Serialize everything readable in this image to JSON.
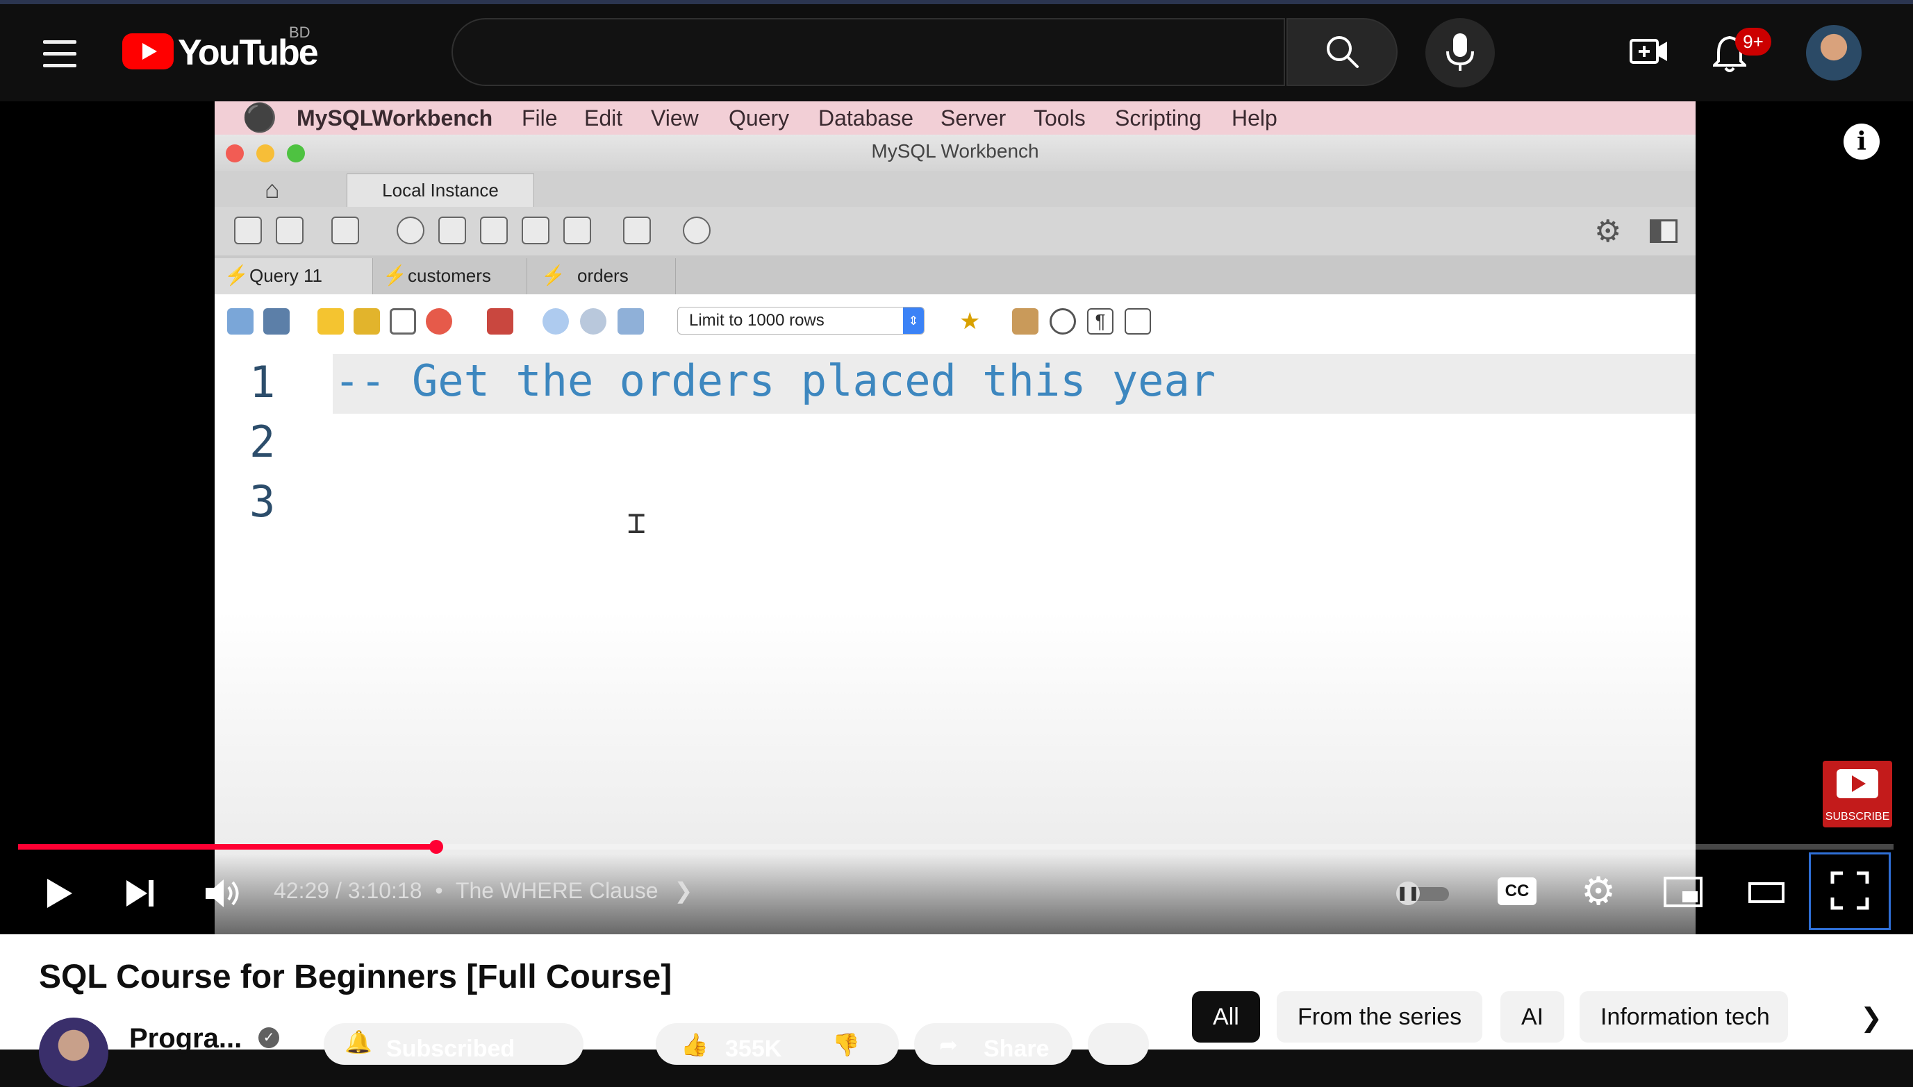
{
  "header": {
    "logo_text": "YouTube",
    "region": "BD",
    "search_placeholder": "",
    "notification_count": "9+",
    "icons": [
      "menu-icon",
      "youtube-logo",
      "search-icon",
      "mic-icon",
      "create-video-icon",
      "bell-icon",
      "avatar"
    ]
  },
  "workbench": {
    "menubar": [
      "MySQLWorkbench",
      "File",
      "Edit",
      "View",
      "Query",
      "Database",
      "Server",
      "Tools",
      "Scripting",
      "Help"
    ],
    "window_title": "MySQL Workbench",
    "instance_tab": "Local Instance",
    "query_tabs": [
      "Query 11",
      "customers",
      "orders"
    ],
    "limit_select": "Limit to 1000 rows",
    "line_numbers": [
      "1",
      "2",
      "3"
    ],
    "code": [
      "-- Get the orders placed this year",
      "",
      ""
    ]
  },
  "player": {
    "time": "42:29 / 3:10:18",
    "chapter": "The WHERE Clause",
    "progress_fraction": 0.223,
    "subscribe_badge": "SUBSCRIBE",
    "info_label": "i",
    "colors": {
      "progress": "#ff0033",
      "menubar": "#f2cfd6",
      "code": "#3d87bf"
    }
  },
  "below": {
    "title": "SQL Course for Beginners [Full Course]",
    "channel": "Progra...",
    "subscribe_label": "Subscribed",
    "like_count": "355K",
    "share_label": "Share",
    "chips": [
      "All",
      "From the series",
      "AI",
      "Information tech"
    ]
  }
}
